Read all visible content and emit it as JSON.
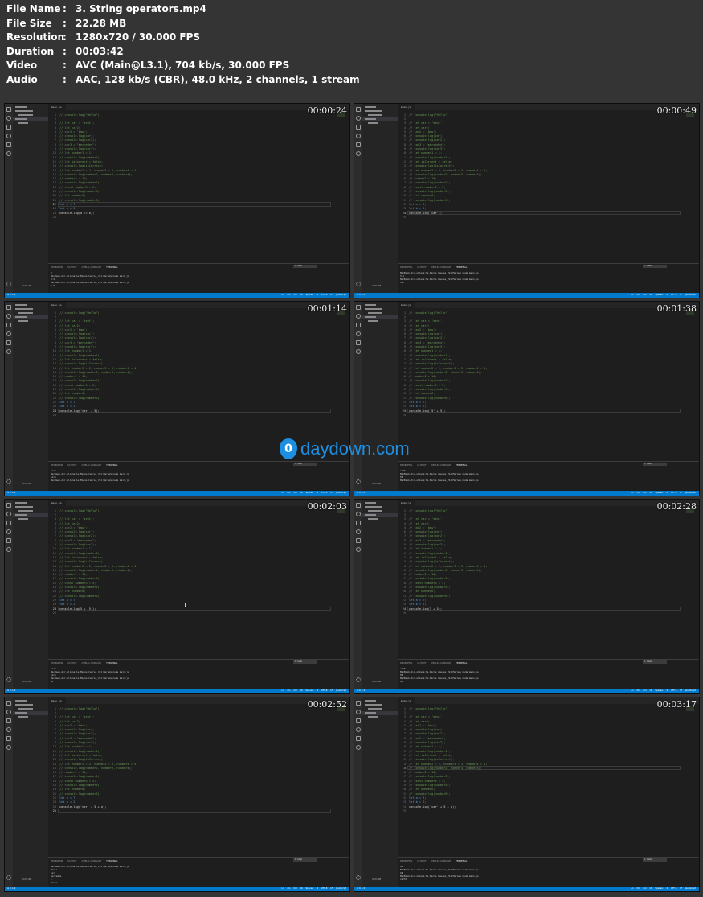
{
  "info": {
    "rows": [
      {
        "key": "File Name",
        "value": "3. String operators.mp4"
      },
      {
        "key": "File Size",
        "value": "22.28 MB"
      },
      {
        "key": "Resolution",
        "value": "1280x720 / 30.000 FPS"
      },
      {
        "key": "Duration",
        "value": "00:03:42"
      },
      {
        "key": "Video",
        "value": "AVC (Main@L3.1), 704 kb/s, 30.000 FPS"
      },
      {
        "key": "Audio",
        "value": "AAC, 128 kb/s (CBR), 48.0 kHz, 2 channels, 1 stream"
      }
    ],
    "separator": ":"
  },
  "editor": {
    "tab_label": "main.js",
    "base_lines": [
      "// console.log(\"Hello\")",
      "",
      "// let car = 'sent';",
      "// let car2;",
      "// car2 = 'bmw';",
      "// console.log(car);",
      "// console.log(car2);",
      "// car3 = \"mercedes\";",
      "// console.log(car3);",
      "// let number1 = 1;",
      "// console.log(number1);",
      "// let isCorrect = false;",
      "// console.log(isCorrect);",
      "// let number2 = 2, number3 = 3, number4 = 4;",
      "// console.log(number2, number3, number4);",
      "// number2 = 10;",
      "// console.log(number2);",
      "// const number5 = 5;",
      "// console.log(number5);",
      "// let number6;",
      "// console.log(number6);",
      "let a = 7;",
      "let b = 2;"
    ]
  },
  "panel": {
    "tabs": [
      "PROBLEMS",
      "OUTPUT",
      "DEBUG CONSOLE",
      "TERMINAL"
    ],
    "select": "1: bash",
    "prompt": "MacBook-Air-uliana:le-Marno Course_JS1 Marno$ node main.js"
  },
  "status": {
    "left": "⊗ 0 ⚠ 0",
    "right": "Ln 24, Col 16  Spaces: 4  UTF-8  LF  JavaScript"
  },
  "thumbnails": [
    {
      "time": "00:00:24",
      "line24": "console.log(a /= b);",
      "line25": "",
      "active": 22,
      "term": [
        "3",
        "MacBook-Air-uliana:le-Marno Course_JS1 Marno$ node main.js",
        "3.5",
        "MacBook-Air-uliana:le-Marno Course_JS1 Marno$ node main.js",
        "3.5"
      ]
    },
    {
      "time": "00:00:49",
      "line24": "console.log('car');",
      "line25": "",
      "active": 24,
      "term": [
        "MacBook-Air-uliana:le-Marno Course_JS1 Marno$ node main.js",
        "3.5",
        "MacBook-Air-uliana:le-Marno Course_JS1 Marno$ node main.js",
        "car"
      ]
    },
    {
      "time": "00:01:14",
      "line24": "console.log('car' + 5);",
      "line25": "",
      "active": 24,
      "term": [
        "car5",
        "MacBook-Air-uliana:le-Marno Course_JS1 Marno$ node main.js",
        "car5",
        "MacBook-Air-uliana:le-Marno Course_JS1 Marno$ node main.js"
      ]
    },
    {
      "time": "00:01:38",
      "line24": "console.log('5' + 5);",
      "line25": "",
      "active": 24,
      "term": [
        "car5",
        "MacBook-Air-uliana:le-Marno Course_JS1 Marno$ node main.js",
        "55",
        "MacBook-Air-uliana:le-Marno Course_JS1 Marno$ node main.js"
      ]
    },
    {
      "time": "00:02:03",
      "line24": "console.log(5 + '5');",
      "line25": "",
      "active": 24,
      "term": [
        "car5",
        "MacBook-Air-uliana:le-Marno Course_JS1 Marno$ node main.js",
        "car5",
        "MacBook-Air-uliana:le-Marno Course_JS1 Marno$ node main.js",
        "55"
      ]
    },
    {
      "time": "00:02:28",
      "line24": "console.log(5 + 5);",
      "line25": "",
      "active": 24,
      "term": [
        "car5",
        "MacBook-Air-uliana:le-Marno Course_JS1 Marno$ node main.js",
        "55",
        "MacBook-Air-uliana:le-Marno Course_JS1 Marno$ node main.js",
        "10"
      ]
    },
    {
      "time": "00:02:52",
      "line24": "console.log('car' + 5 + a);",
      "line25": "",
      "active": 25,
      "term": [
        "MacBook-Air-uliana:le-Marno Course_JS1 Marno$ node main.js",
        "Hello",
        "car",
        "mercedes",
        "1",
        "false"
      ]
    },
    {
      "time": "00:03:17",
      "line24": "console.log('car' + 5 + a);",
      "line25": "",
      "active": 15,
      "term": [
        "10",
        "MacBook-Air-uliana:le-Marno Course_JS1 Marno$ node main.js",
        "10",
        "MacBook-Air-uliana:le-Marno Course_JS1 Marno$ node main.js",
        "car57"
      ]
    }
  ],
  "watermark": {
    "icon_char": "0",
    "text": "daydown.com",
    "color": "#1d8fe1"
  },
  "colors": {
    "status_bar": "#007acc",
    "editor_bg": "#1e1e1e",
    "comment": "#6a9955",
    "keyword": "#569cd6"
  }
}
